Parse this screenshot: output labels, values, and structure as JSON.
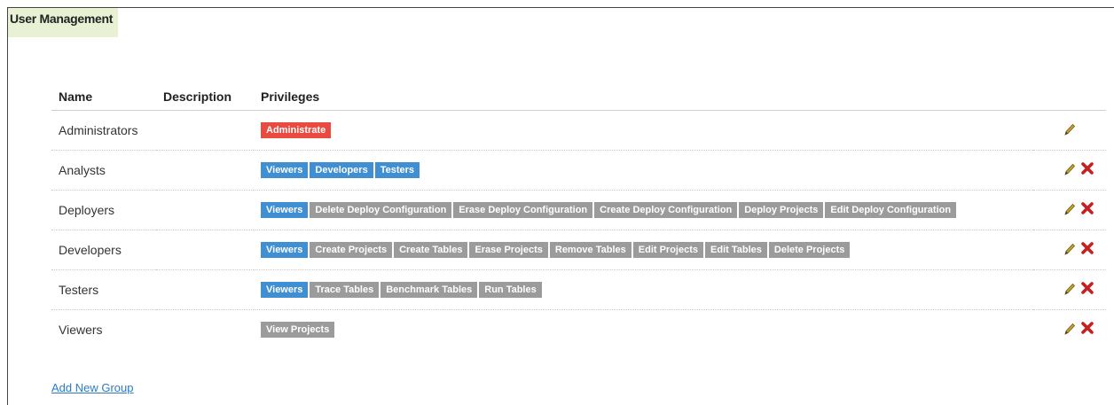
{
  "page": {
    "title": "User Management"
  },
  "table": {
    "headers": {
      "name": "Name",
      "description": "Description",
      "privileges": "Privileges"
    },
    "rows": [
      {
        "name": "Administrators",
        "description": "",
        "privileges": [
          {
            "label": "Administrate",
            "color": "red"
          }
        ],
        "deletable": false
      },
      {
        "name": "Analysts",
        "description": "",
        "privileges": [
          {
            "label": "Viewers",
            "color": "blue"
          },
          {
            "label": "Developers",
            "color": "blue"
          },
          {
            "label": "Testers",
            "color": "blue"
          }
        ],
        "deletable": true
      },
      {
        "name": "Deployers",
        "description": "",
        "privileges": [
          {
            "label": "Viewers",
            "color": "blue"
          },
          {
            "label": "Delete Deploy Configuration",
            "color": "gray"
          },
          {
            "label": "Erase Deploy Configuration",
            "color": "gray"
          },
          {
            "label": "Create Deploy Configuration",
            "color": "gray"
          },
          {
            "label": "Deploy Projects",
            "color": "gray"
          },
          {
            "label": "Edit Deploy Configuration",
            "color": "gray"
          }
        ],
        "deletable": true
      },
      {
        "name": "Developers",
        "description": "",
        "privileges": [
          {
            "label": "Viewers",
            "color": "blue"
          },
          {
            "label": "Create Projects",
            "color": "gray"
          },
          {
            "label": "Create Tables",
            "color": "gray"
          },
          {
            "label": "Erase Projects",
            "color": "gray"
          },
          {
            "label": "Remove Tables",
            "color": "gray"
          },
          {
            "label": "Edit Projects",
            "color": "gray"
          },
          {
            "label": "Edit Tables",
            "color": "gray"
          },
          {
            "label": "Delete Projects",
            "color": "gray"
          }
        ],
        "deletable": true
      },
      {
        "name": "Testers",
        "description": "",
        "privileges": [
          {
            "label": "Viewers",
            "color": "blue"
          },
          {
            "label": "Trace Tables",
            "color": "gray"
          },
          {
            "label": "Benchmark Tables",
            "color": "gray"
          },
          {
            "label": "Run Tables",
            "color": "gray"
          }
        ],
        "deletable": true
      },
      {
        "name": "Viewers",
        "description": "",
        "privileges": [
          {
            "label": "View Projects",
            "color": "gray"
          }
        ],
        "deletable": true
      }
    ]
  },
  "icons": {
    "edit": "pencil-icon",
    "delete": "close-icon"
  },
  "colors": {
    "red": "#e94b40",
    "blue": "#3f8fd2",
    "gray": "#9b9b9b",
    "link": "#2a7ac7",
    "title_bg": "#e8f1d4"
  },
  "footer": {
    "add_link": "Add New Group"
  }
}
